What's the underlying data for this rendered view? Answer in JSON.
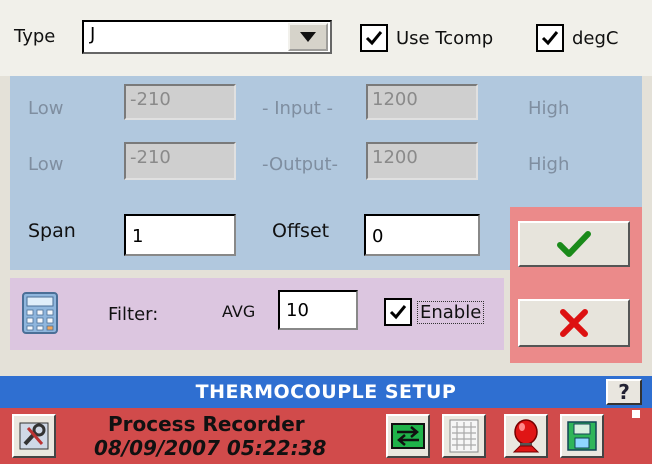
{
  "top": {
    "type_label": "Type",
    "type_value": "J",
    "use_tcomp": {
      "label": "Use Tcomp",
      "checked": true
    },
    "degc": {
      "label": "degC",
      "checked": true
    }
  },
  "scaling": {
    "input_row": {
      "low_label": "Low",
      "low_value": "-210",
      "center_label": "- Input -",
      "high_value": "1200",
      "high_label": "High"
    },
    "output_row": {
      "low_label": "Low",
      "low_value": "-210",
      "center_label": "-Output-",
      "high_value": "1200",
      "high_label": "High"
    },
    "span_label": "Span",
    "span_value": "1",
    "offset_label": "Offset",
    "offset_value": "0"
  },
  "filter": {
    "label": "Filter:",
    "avg_label": "AVG",
    "avg_value": "10",
    "enable_label": "Enable",
    "enable_checked": true
  },
  "actions": {
    "ok_icon": "checkmark-icon",
    "cancel_icon": "x-icon",
    "ok_color": "#1a8a1a",
    "cancel_color": "#dd1111"
  },
  "titlebar": {
    "title": "THERMOCOUPLE SETUP",
    "help_label": "?"
  },
  "status": {
    "app_name": "Process Recorder",
    "datetime": "08/09/2007 05:22:38",
    "icons": [
      "tools-icon",
      "exchange-icon",
      "grid-icon",
      "alarm-icon",
      "save-icon"
    ]
  },
  "colors": {
    "panel_blue": "#b1c8de",
    "panel_pink": "#dcc6e0",
    "panel_red": "#eb8a8a",
    "title_blue": "#2f6fd1",
    "status_red": "#d14b4b"
  }
}
